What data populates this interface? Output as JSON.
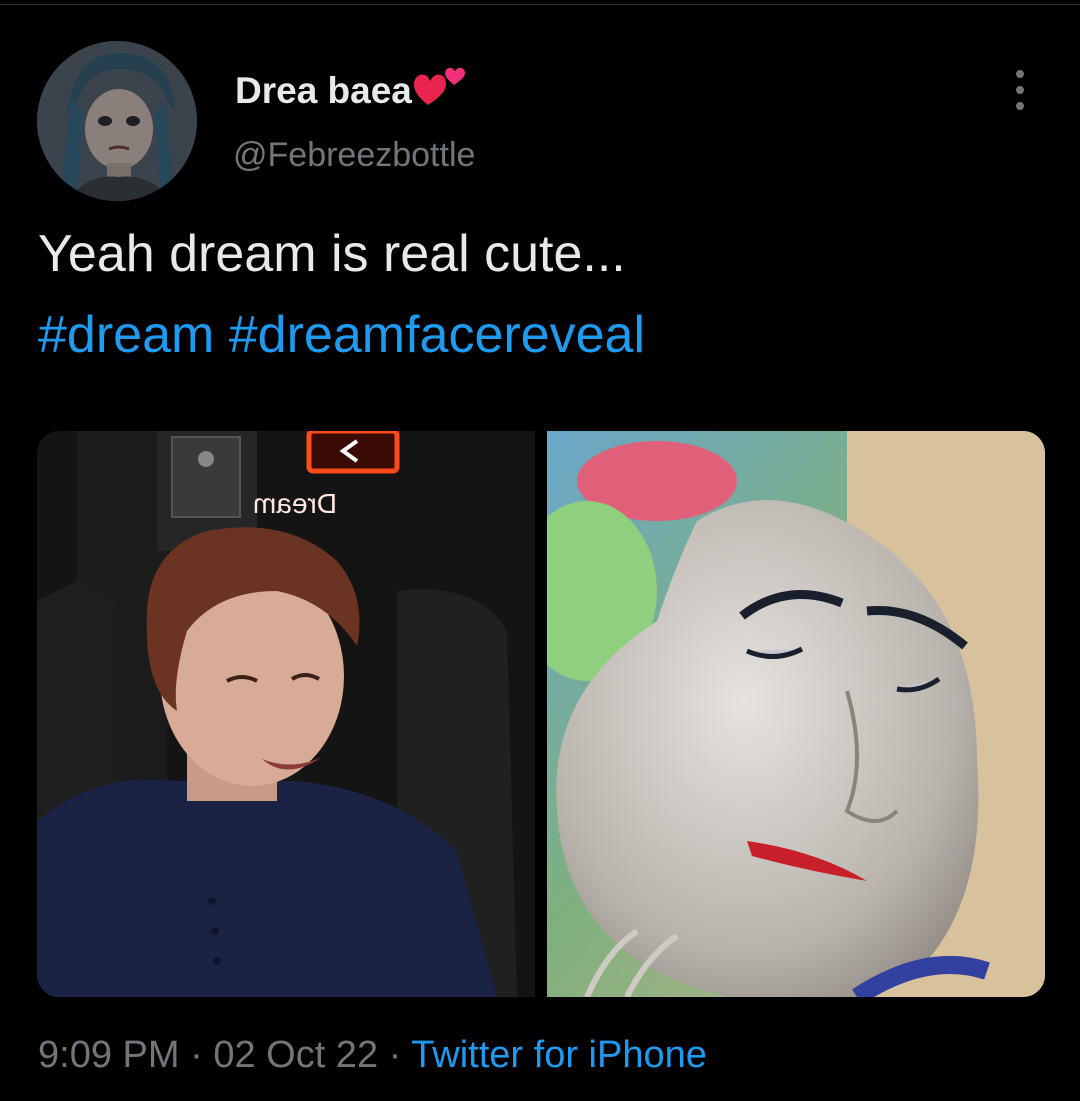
{
  "theme": {
    "background": "#000000",
    "text_primary": "#e7e9ea",
    "text_secondary": "#71767b",
    "link": "#1d9bf0"
  },
  "author": {
    "display_name": "Drea baea",
    "handle": "@Febreezbottle",
    "avatar_icon": "avatar-image",
    "name_emoji": "two-hearts-icon"
  },
  "tweet": {
    "text": "Yeah dream is real cute...",
    "hashtags": [
      "#dream",
      "#dreamfacereveal"
    ],
    "media": [
      {
        "label": "photo-streamer"
      },
      {
        "label": "photo-meme-face"
      }
    ],
    "neon_sign_text": "Dream"
  },
  "meta": {
    "time": "9:09 PM",
    "separator": "·",
    "date": "02 Oct 22",
    "source": "Twitter for iPhone"
  }
}
